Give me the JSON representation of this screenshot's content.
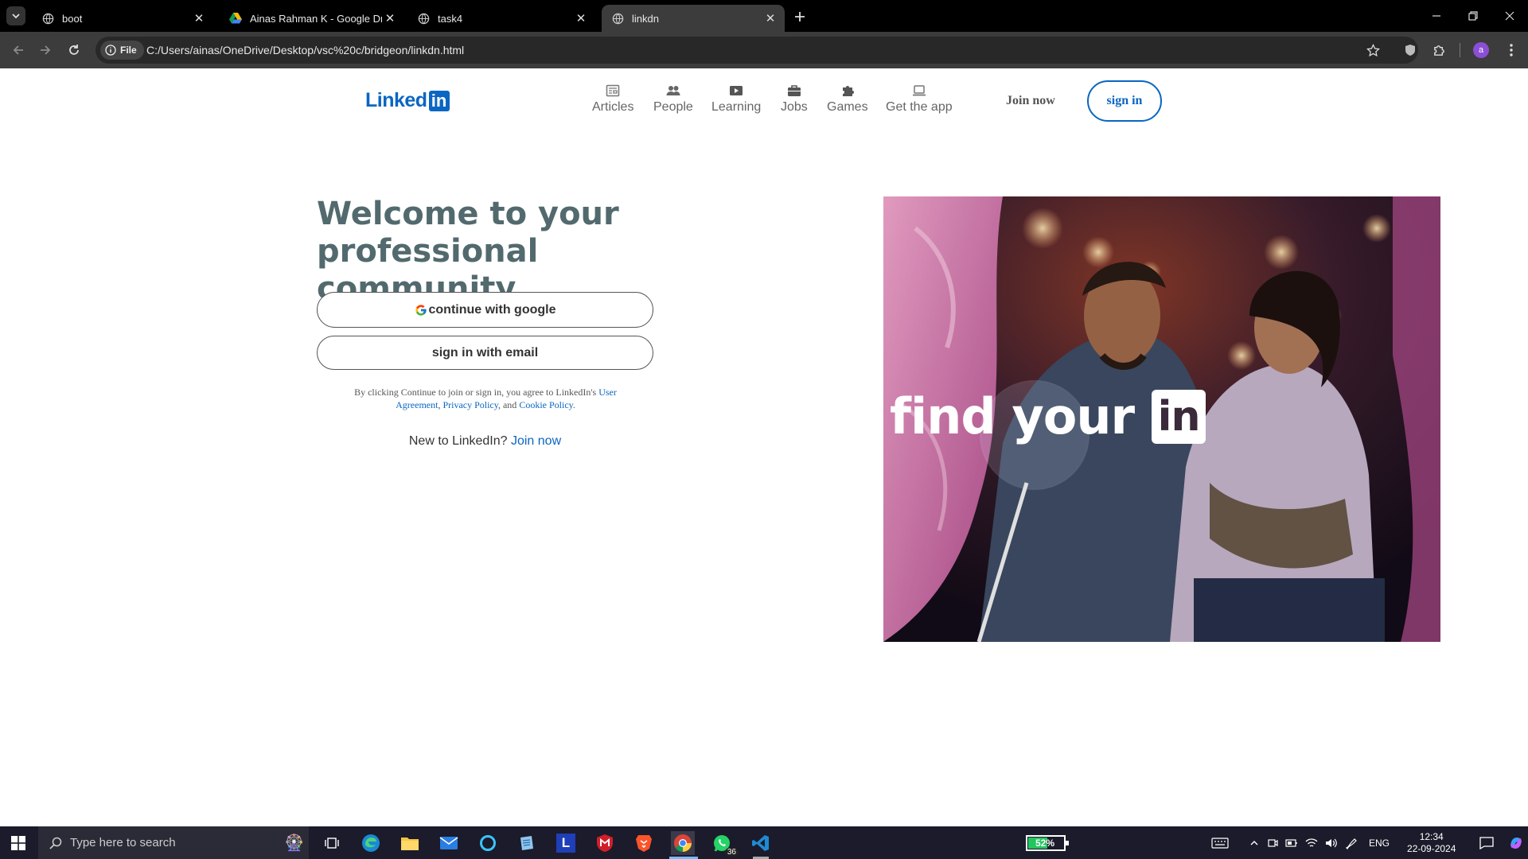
{
  "browser": {
    "tabs": [
      {
        "title": "boot",
        "active": false
      },
      {
        "title": "Ainas Rahman K - Google Drive",
        "active": false
      },
      {
        "title": "task4",
        "active": false
      },
      {
        "title": "linkdn",
        "active": true
      }
    ],
    "file_chip": "File",
    "url": "C:/Users/ainas/OneDrive/Desktop/vsc%20c/bridgeon/linkdn.html",
    "profile_initial": "a"
  },
  "header": {
    "logo_text": "Linked",
    "logo_box": "in",
    "nav": [
      {
        "label": "Articles",
        "icon": "newspaper-icon"
      },
      {
        "label": "People",
        "icon": "people-icon"
      },
      {
        "label": "Learning",
        "icon": "play-video-icon"
      },
      {
        "label": "Jobs",
        "icon": "briefcase-icon"
      },
      {
        "label": "Games",
        "icon": "puzzle-icon"
      },
      {
        "label": "Get the app",
        "icon": "laptop-icon"
      }
    ],
    "join_now": "Join now",
    "sign_in": "sign in"
  },
  "main": {
    "headline": "Welcome to your professional community",
    "google_button": "continue with google",
    "email_button": "sign in with email",
    "legal": {
      "prefix": "By clicking Continue to join or sign in, you agree to LinkedIn's",
      "user_agreement": "User Agreement",
      "privacy_policy": "Privacy Policy",
      "and": ", and",
      "cookie_policy": "Cookie Policy"
    },
    "new_to": "New to LinkedIn?",
    "join_link": "Join now"
  },
  "hero": {
    "text": "find your",
    "badge": "in"
  },
  "taskbar": {
    "search_placeholder": "Type here to search",
    "battery": "52%",
    "whatsapp_badge": "36",
    "language": "ENG",
    "time": "12:34",
    "date": "22-09-2024"
  },
  "colors": {
    "linkedin_blue": "#0a66c2",
    "headline": "#526a6e"
  }
}
